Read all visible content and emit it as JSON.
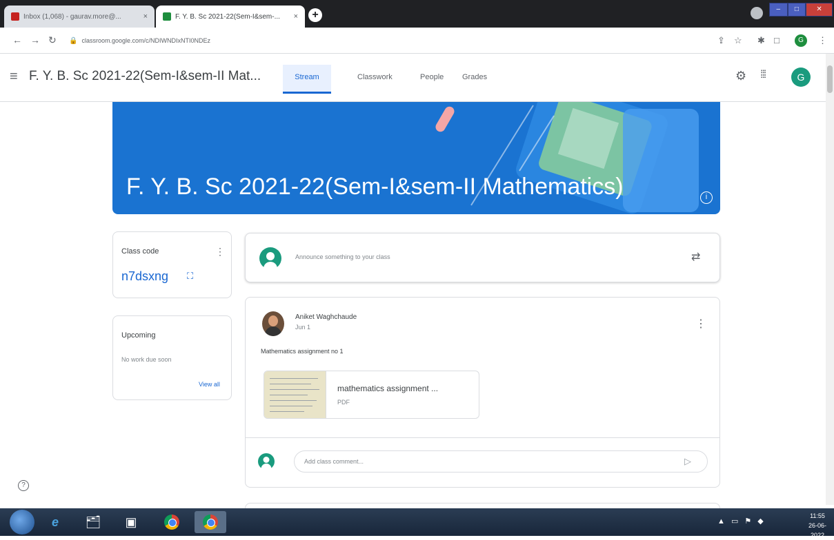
{
  "browser": {
    "tabs": [
      {
        "title": "Inbox (1,068) - gaurav.more@...",
        "favicon_color": "#c5221f"
      },
      {
        "title": "F. Y. B. Sc 2021-22(Sem-I&sem-...",
        "favicon_color": "#1e8e3e"
      }
    ],
    "new_tab_label": "+",
    "close_glyph": "×",
    "url": "classroom.google.com/c/NDIWNDIxNTI0NDEz"
  },
  "header": {
    "class_title": "F. Y. B. Sc 2021-22(Sem-I&sem-II Mat...",
    "nav_tabs": [
      "Stream",
      "Classwork",
      "People",
      "Grades"
    ],
    "active_tab": "Stream",
    "account_initial": "G"
  },
  "banner": {
    "title": "F. Y. B. Sc 2021-22(Sem-I&sem-II Mathematics)",
    "info_glyph": "i"
  },
  "class_code": {
    "label": "Class code",
    "value": "n7dsxng"
  },
  "upcoming": {
    "title": "Upcoming",
    "empty_text": "No work due soon",
    "view_all": "View all"
  },
  "announce": {
    "placeholder": "Announce something to your class"
  },
  "post": {
    "author": "Aniket Waghchaude",
    "date": "Jun 1",
    "text": "Mathematics assignment no 1",
    "attachment": {
      "name": "mathematics assignment ...",
      "type": "PDF"
    },
    "comment_placeholder": "Add class comment..."
  },
  "taskbar": {
    "clock_time": "11:55",
    "clock_date": "26-06-2022"
  },
  "colors": {
    "accent": "#1967d2",
    "banner": "#1a73d1",
    "avatar": "#1a9b7e"
  }
}
